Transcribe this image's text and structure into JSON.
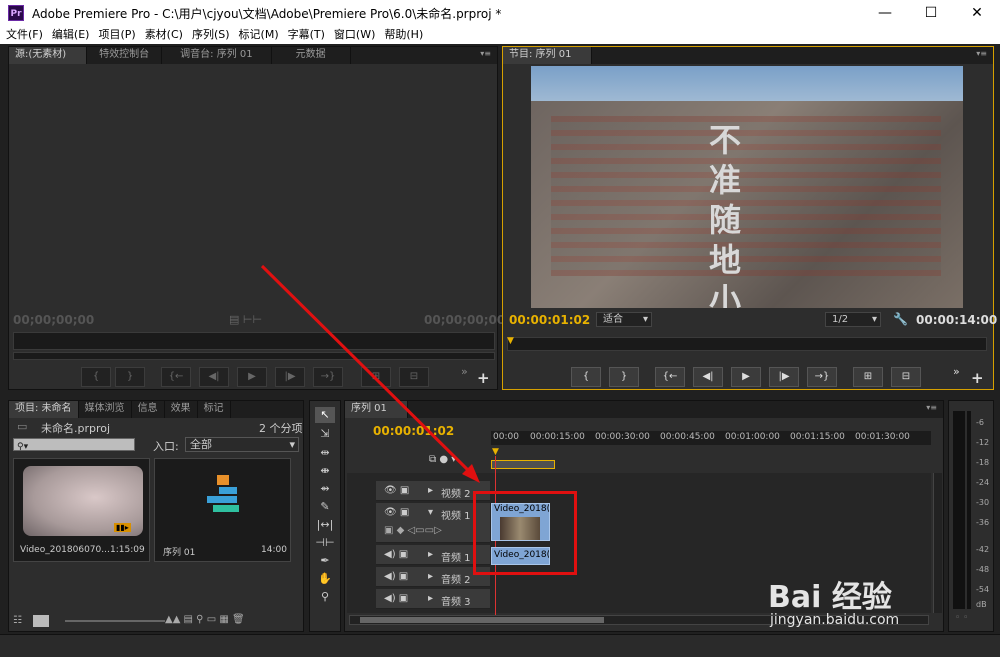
{
  "window": {
    "app_icon": "Pr",
    "title": "Adobe Premiere Pro - C:\\用户\\cjyou\\文档\\Adobe\\Premiere Pro\\6.0\\未命名.prproj *",
    "minimize": "—",
    "maximize": "☐",
    "close": "✕"
  },
  "menu": [
    "文件(F)",
    "编辑(E)",
    "项目(P)",
    "素材(C)",
    "序列(S)",
    "标记(M)",
    "字幕(T)",
    "窗口(W)",
    "帮助(H)"
  ],
  "source_panel": {
    "tabs": [
      "源:(无素材)",
      "特效控制台",
      "调音台: 序列 01",
      "元数据"
    ],
    "tc_left": "00;00;00;00",
    "tc_right": "00;00;00;00"
  },
  "program_panel": {
    "tab": "节目: 序列 01",
    "current_tc": "00:00:01:02",
    "fit": "适合",
    "resolution": "1/2",
    "duration": "00:00:14:00",
    "overlay_text": "不准随地小便"
  },
  "project_panel": {
    "tabs": [
      "项目: 未命名",
      "媒体浏览",
      "信息",
      "效果",
      "标记"
    ],
    "filename": "未命名.prproj",
    "count": "2 个分项",
    "entry_label": "入口:",
    "entry_value": "全部",
    "items": [
      {
        "name": "Video_201806070...",
        "duration": "1:15:09"
      },
      {
        "name": "序列 01",
        "duration": "14:00"
      }
    ]
  },
  "timeline": {
    "tab": "序列 01",
    "current_tc": "00:00:01:02",
    "ruler": [
      "00:00",
      "00:00:15:00",
      "00:00:30:00",
      "00:00:45:00",
      "00:01:00:00",
      "00:01:15:00",
      "00:01:30:00"
    ],
    "tracks": [
      "视频 2",
      "视频 1",
      "音频 1",
      "音频 2",
      "音频 3"
    ],
    "video_clip": "Video_2018(",
    "audio_clip": "Video_2018("
  },
  "meter": {
    "labels": [
      "-6",
      "-12",
      "-18",
      "-24",
      "-30",
      "-36",
      "-42",
      "-48",
      "-54",
      "dB"
    ]
  },
  "watermark": {
    "brand": "Bai  经验",
    "url": "jingyan.baidu.com"
  },
  "colors": {
    "gold": "#e8b200",
    "annotation": "#e01010",
    "clip": "#7fa5d4"
  }
}
